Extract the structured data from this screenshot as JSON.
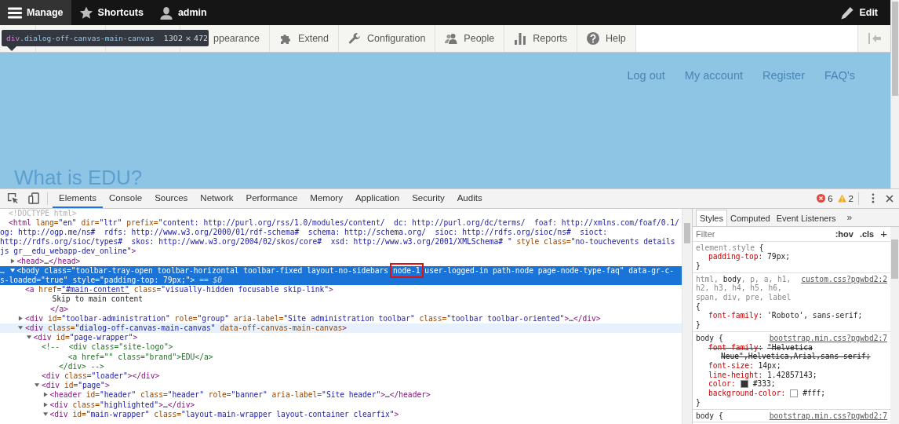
{
  "toolbar": {
    "items": [
      {
        "label": "Manage",
        "selected": true
      },
      {
        "label": "Shortcuts",
        "selected": false
      },
      {
        "label": "admin",
        "selected": false
      }
    ],
    "edit": "Edit"
  },
  "tray": {
    "tabs": [
      {
        "label": "ppearance"
      },
      {
        "label": "Extend"
      },
      {
        "label": "Configuration"
      },
      {
        "label": "People"
      },
      {
        "label": "Reports"
      },
      {
        "label": "Help"
      }
    ]
  },
  "tooltip": {
    "tag": "div",
    "class": ".dialog-off-canvas-main-canvas",
    "size": "1302 × 472"
  },
  "site": {
    "links": [
      "Log out",
      "My account",
      "Register",
      "FAQ's"
    ],
    "heading": "What is EDU?"
  },
  "devtools": {
    "tabs": [
      {
        "label": "Elements",
        "selected": true
      },
      {
        "label": "Console",
        "selected": false
      },
      {
        "label": "Sources",
        "selected": false
      },
      {
        "label": "Network",
        "selected": false
      },
      {
        "label": "Performance",
        "selected": false
      },
      {
        "label": "Memory",
        "selected": false
      },
      {
        "label": "Application",
        "selected": false
      },
      {
        "label": "Security",
        "selected": false
      },
      {
        "label": "Audits",
        "selected": false
      }
    ],
    "errors": "6",
    "warnings": "2",
    "dom": [
      {
        "kind": "plain",
        "selected": false,
        "hovered": false,
        "tokens": [
          {
            "kind": "doctype",
            "text": "<!DOCTYPE html>"
          }
        ]
      },
      {
        "kind": "plain",
        "selected": false,
        "hovered": false,
        "tokens": [
          {
            "kind": "tag",
            "text": "<html"
          },
          {
            "kind": "attr",
            "text": " lang="
          },
          {
            "kind": "value",
            "text": "\"en\""
          },
          {
            "kind": "attr",
            "text": " dir="
          },
          {
            "kind": "value",
            "text": "\"ltr\""
          },
          {
            "kind": "attr",
            "text": " prefix="
          },
          {
            "kind": "value",
            "text": "\"content: http://purl.org/rss/1.0/modules/content/  dc: http://purl.org/dc/terms/  foaf: http://xmlns.com/foaf/0.1/  og: http://ogp.me/ns#  rdfs: http://www.w3.org/2000/01/rdf-schema#  schema: http://schema.org/  sioc: http://rdfs.org/sioc/ns#  sioct: http://rdfs.org/sioc/types#  skos: http://www.w3.org/2004/02/skos/core#  xsd: http://www.w3.org/2001/XMLSchema# \""
          },
          {
            "kind": "attr",
            "text": " style class="
          },
          {
            "kind": "value",
            "text": "\"no-touchevents details js gr__edu_webapp-dev_online\""
          },
          {
            "kind": "tag",
            "text": ">"
          }
        ],
        "children": [
          {
            "kind": "branch",
            "expanded": false,
            "selected": false,
            "hovered": false,
            "tokens": [
              {
                "kind": "tag",
                "text": "<head>"
              },
              {
                "kind": "text",
                "text": "…"
              },
              {
                "kind": "tag",
                "text": "</head>"
              }
            ]
          },
          {
            "kind": "branch",
            "expanded": true,
            "selected": true,
            "hovered": false,
            "gutter": "…",
            "tokens": [
              {
                "kind": "tag",
                "text": "<body"
              },
              {
                "kind": "attr",
                "text": " class="
              },
              {
                "kind": "value",
                "text": "\"toolbar-tray-open toolbar-horizontal toolbar-fixed layout-no-sidebars "
              },
              {
                "kind": "boxed",
                "text": "node-1"
              },
              {
                "kind": "value",
                "text": " user-logged-in path-node page-node-type-faq\""
              },
              {
                "kind": "attr",
                "text": " data-gr-c-s-loaded="
              },
              {
                "kind": "value",
                "text": "\"true\""
              },
              {
                "kind": "attr",
                "text": " style="
              },
              {
                "kind": "value",
                "text": "\"padding-top: 79px;\""
              },
              {
                "kind": "tag",
                "text": ">"
              },
              {
                "kind": "dim",
                "text": " == $0"
              }
            ],
            "children": [
              {
                "kind": "plain",
                "selected": false,
                "hovered": false,
                "tokens": [
                  {
                    "kind": "tag",
                    "text": "<a"
                  },
                  {
                    "kind": "attr",
                    "text": " href="
                  },
                  {
                    "kind": "link",
                    "text": "\"#main-content\""
                  },
                  {
                    "kind": "attr",
                    "text": " class="
                  },
                  {
                    "kind": "value",
                    "text": "\"visually-hidden focusable skip-link\""
                  },
                  {
                    "kind": "tag",
                    "text": ">"
                  }
                ],
                "children": [
                  {
                    "kind": "text",
                    "selected": false,
                    "hovered": false,
                    "tokens": [
                      {
                        "kind": "text",
                        "text": "Skip to main content"
                      }
                    ]
                  }
                ],
                "close": [
                  {
                    "kind": "tag",
                    "text": "</a>"
                  }
                ]
              },
              {
                "kind": "branch",
                "expanded": false,
                "selected": false,
                "hovered": false,
                "tokens": [
                  {
                    "kind": "tag",
                    "text": "<div"
                  },
                  {
                    "kind": "attr",
                    "text": " id="
                  },
                  {
                    "kind": "value",
                    "text": "\"toolbar-administration\""
                  },
                  {
                    "kind": "attr",
                    "text": " role="
                  },
                  {
                    "kind": "value",
                    "text": "\"group\""
                  },
                  {
                    "kind": "attr",
                    "text": " aria-label="
                  },
                  {
                    "kind": "value",
                    "text": "\"Site administration toolbar\""
                  },
                  {
                    "kind": "attr",
                    "text": " class="
                  },
                  {
                    "kind": "value",
                    "text": "\"toolbar toolbar-oriented\""
                  },
                  {
                    "kind": "tag",
                    "text": ">"
                  },
                  {
                    "kind": "text",
                    "text": "…"
                  },
                  {
                    "kind": "tag",
                    "text": "</div>"
                  }
                ]
              },
              {
                "kind": "branch",
                "expanded": true,
                "selected": false,
                "hovered": true,
                "tokens": [
                  {
                    "kind": "tag",
                    "text": "<div"
                  },
                  {
                    "kind": "attr",
                    "text": " class="
                  },
                  {
                    "kind": "value",
                    "text": "\"dialog-off-canvas-main-canvas\""
                  },
                  {
                    "kind": "attr",
                    "text": " data-off-canvas-main-canvas"
                  },
                  {
                    "kind": "tag",
                    "text": ">"
                  }
                ],
                "children": [
                  {
                    "kind": "branch",
                    "expanded": true,
                    "selected": false,
                    "hovered": false,
                    "tokens": [
                      {
                        "kind": "tag",
                        "text": "<div"
                      },
                      {
                        "kind": "attr",
                        "text": " id="
                      },
                      {
                        "kind": "value",
                        "text": "\"page-wrapper\""
                      },
                      {
                        "kind": "tag",
                        "text": ">"
                      }
                    ],
                    "children": [
                      {
                        "kind": "comment",
                        "selected": false,
                        "hovered": false,
                        "tokens": [
                          {
                            "kind": "comment",
                            "text": "<!--  <div class=\"site-logo\">\n               <a href=\"\" class=\"brand\">EDU</a>\n             </div> -->"
                          }
                        ]
                      },
                      {
                        "kind": "plain",
                        "selected": false,
                        "hovered": false,
                        "tokens": [
                          {
                            "kind": "tag",
                            "text": "<div"
                          },
                          {
                            "kind": "attr",
                            "text": " class="
                          },
                          {
                            "kind": "value",
                            "text": "\"loader\""
                          },
                          {
                            "kind": "tag",
                            "text": "></div>"
                          }
                        ]
                      },
                      {
                        "kind": "branch",
                        "expanded": true,
                        "selected": false,
                        "hovered": false,
                        "tokens": [
                          {
                            "kind": "tag",
                            "text": "<div"
                          },
                          {
                            "kind": "attr",
                            "text": " id="
                          },
                          {
                            "kind": "value",
                            "text": "\"page\""
                          },
                          {
                            "kind": "tag",
                            "text": ">"
                          }
                        ],
                        "children": [
                          {
                            "kind": "branch",
                            "expanded": false,
                            "selected": false,
                            "hovered": false,
                            "tokens": [
                              {
                                "kind": "tag",
                                "text": "<header"
                              },
                              {
                                "kind": "attr",
                                "text": " id="
                              },
                              {
                                "kind": "value",
                                "text": "\"header\""
                              },
                              {
                                "kind": "attr",
                                "text": " class="
                              },
                              {
                                "kind": "value",
                                "text": "\"header\""
                              },
                              {
                                "kind": "attr",
                                "text": " role="
                              },
                              {
                                "kind": "value",
                                "text": "\"banner\""
                              },
                              {
                                "kind": "attr",
                                "text": " aria-label="
                              },
                              {
                                "kind": "value",
                                "text": "\"Site header\""
                              },
                              {
                                "kind": "tag",
                                "text": ">"
                              },
                              {
                                "kind": "text",
                                "text": "…"
                              },
                              {
                                "kind": "tag",
                                "text": "</header>"
                              }
                            ]
                          },
                          {
                            "kind": "branch",
                            "expanded": false,
                            "selected": false,
                            "hovered": false,
                            "tokens": [
                              {
                                "kind": "tag",
                                "text": "<div"
                              },
                              {
                                "kind": "attr",
                                "text": " class="
                              },
                              {
                                "kind": "value",
                                "text": "\"highlighted\""
                              },
                              {
                                "kind": "tag",
                                "text": ">"
                              },
                              {
                                "kind": "text",
                                "text": "…"
                              },
                              {
                                "kind": "tag",
                                "text": "</div>"
                              }
                            ]
                          },
                          {
                            "kind": "branch",
                            "expanded": true,
                            "selected": false,
                            "hovered": false,
                            "tokens": [
                              {
                                "kind": "tag",
                                "text": "<div"
                              },
                              {
                                "kind": "attr",
                                "text": " id="
                              },
                              {
                                "kind": "value",
                                "text": "\"main-wrapper\""
                              },
                              {
                                "kind": "attr",
                                "text": " class="
                              },
                              {
                                "kind": "value",
                                "text": "\"layout-main-wrapper layout-container clearfix\""
                              },
                              {
                                "kind": "tag",
                                "text": ">"
                              }
                            ]
                          }
                        ]
                      }
                    ]
                  }
                ]
              }
            ]
          }
        ]
      }
    ],
    "styles": {
      "tabs": [
        {
          "label": "Styles",
          "selected": true
        },
        {
          "label": "Computed",
          "selected": false
        },
        {
          "label": "Event Listeners",
          "selected": false
        }
      ],
      "more": "»",
      "filter_placeholder": "Filter",
      "hov": ":hov",
      "cls": ".cls",
      "plus": "+",
      "rules": [
        {
          "selector": [
            {
              "kind": "unmatched",
              "text": "element.style"
            },
            {
              "kind": "plain",
              "text": " {"
            }
          ],
          "decls": [
            {
              "kind": "plain",
              "property": "padding-top:",
              "value": "79px;",
              "struck": false
            }
          ],
          "close": "}"
        },
        {
          "source": "custom.css?pgwbd2:2",
          "selector": [
            {
              "kind": "unmatched",
              "text": "html, "
            },
            {
              "kind": "matched",
              "text": "body"
            },
            {
              "kind": "unmatched",
              "text": ", p, a, h1, h2, h3, h4, h5, h6, span, div, pre, label"
            },
            {
              "kind": "plain",
              "text": " {"
            }
          ],
          "decls": [
            {
              "kind": "plain",
              "property": "font-family:",
              "value": "'Roboto', sans-serif;",
              "struck": false
            }
          ],
          "close": "}"
        },
        {
          "source": "bootstrap.min.css?pgwbd2:7",
          "selector": [
            {
              "kind": "matched",
              "text": "body"
            },
            {
              "kind": "plain",
              "text": " {"
            }
          ],
          "decls": [
            {
              "kind": "plain",
              "property": "font-family:",
              "value": "\"Helvetica Neue\",Helvetica,Arial,sans-serif;",
              "struck": true
            },
            {
              "kind": "plain",
              "property": "font-size:",
              "value": "14px;",
              "struck": false
            },
            {
              "kind": "plain",
              "property": "line-height:",
              "value": "1.42857143;",
              "struck": false
            },
            {
              "kind": "color",
              "property": "color:",
              "value": "#333;",
              "struck": false
            },
            {
              "kind": "color",
              "property": "background-color:",
              "value": "#fff;",
              "struck": false
            }
          ],
          "close": "}"
        },
        {
          "source": "bootstrap.min.css?pgwbd2:7",
          "selector": [
            {
              "kind": "matched",
              "text": "body"
            },
            {
              "kind": "plain",
              "text": " {"
            }
          ]
        }
      ]
    }
  }
}
